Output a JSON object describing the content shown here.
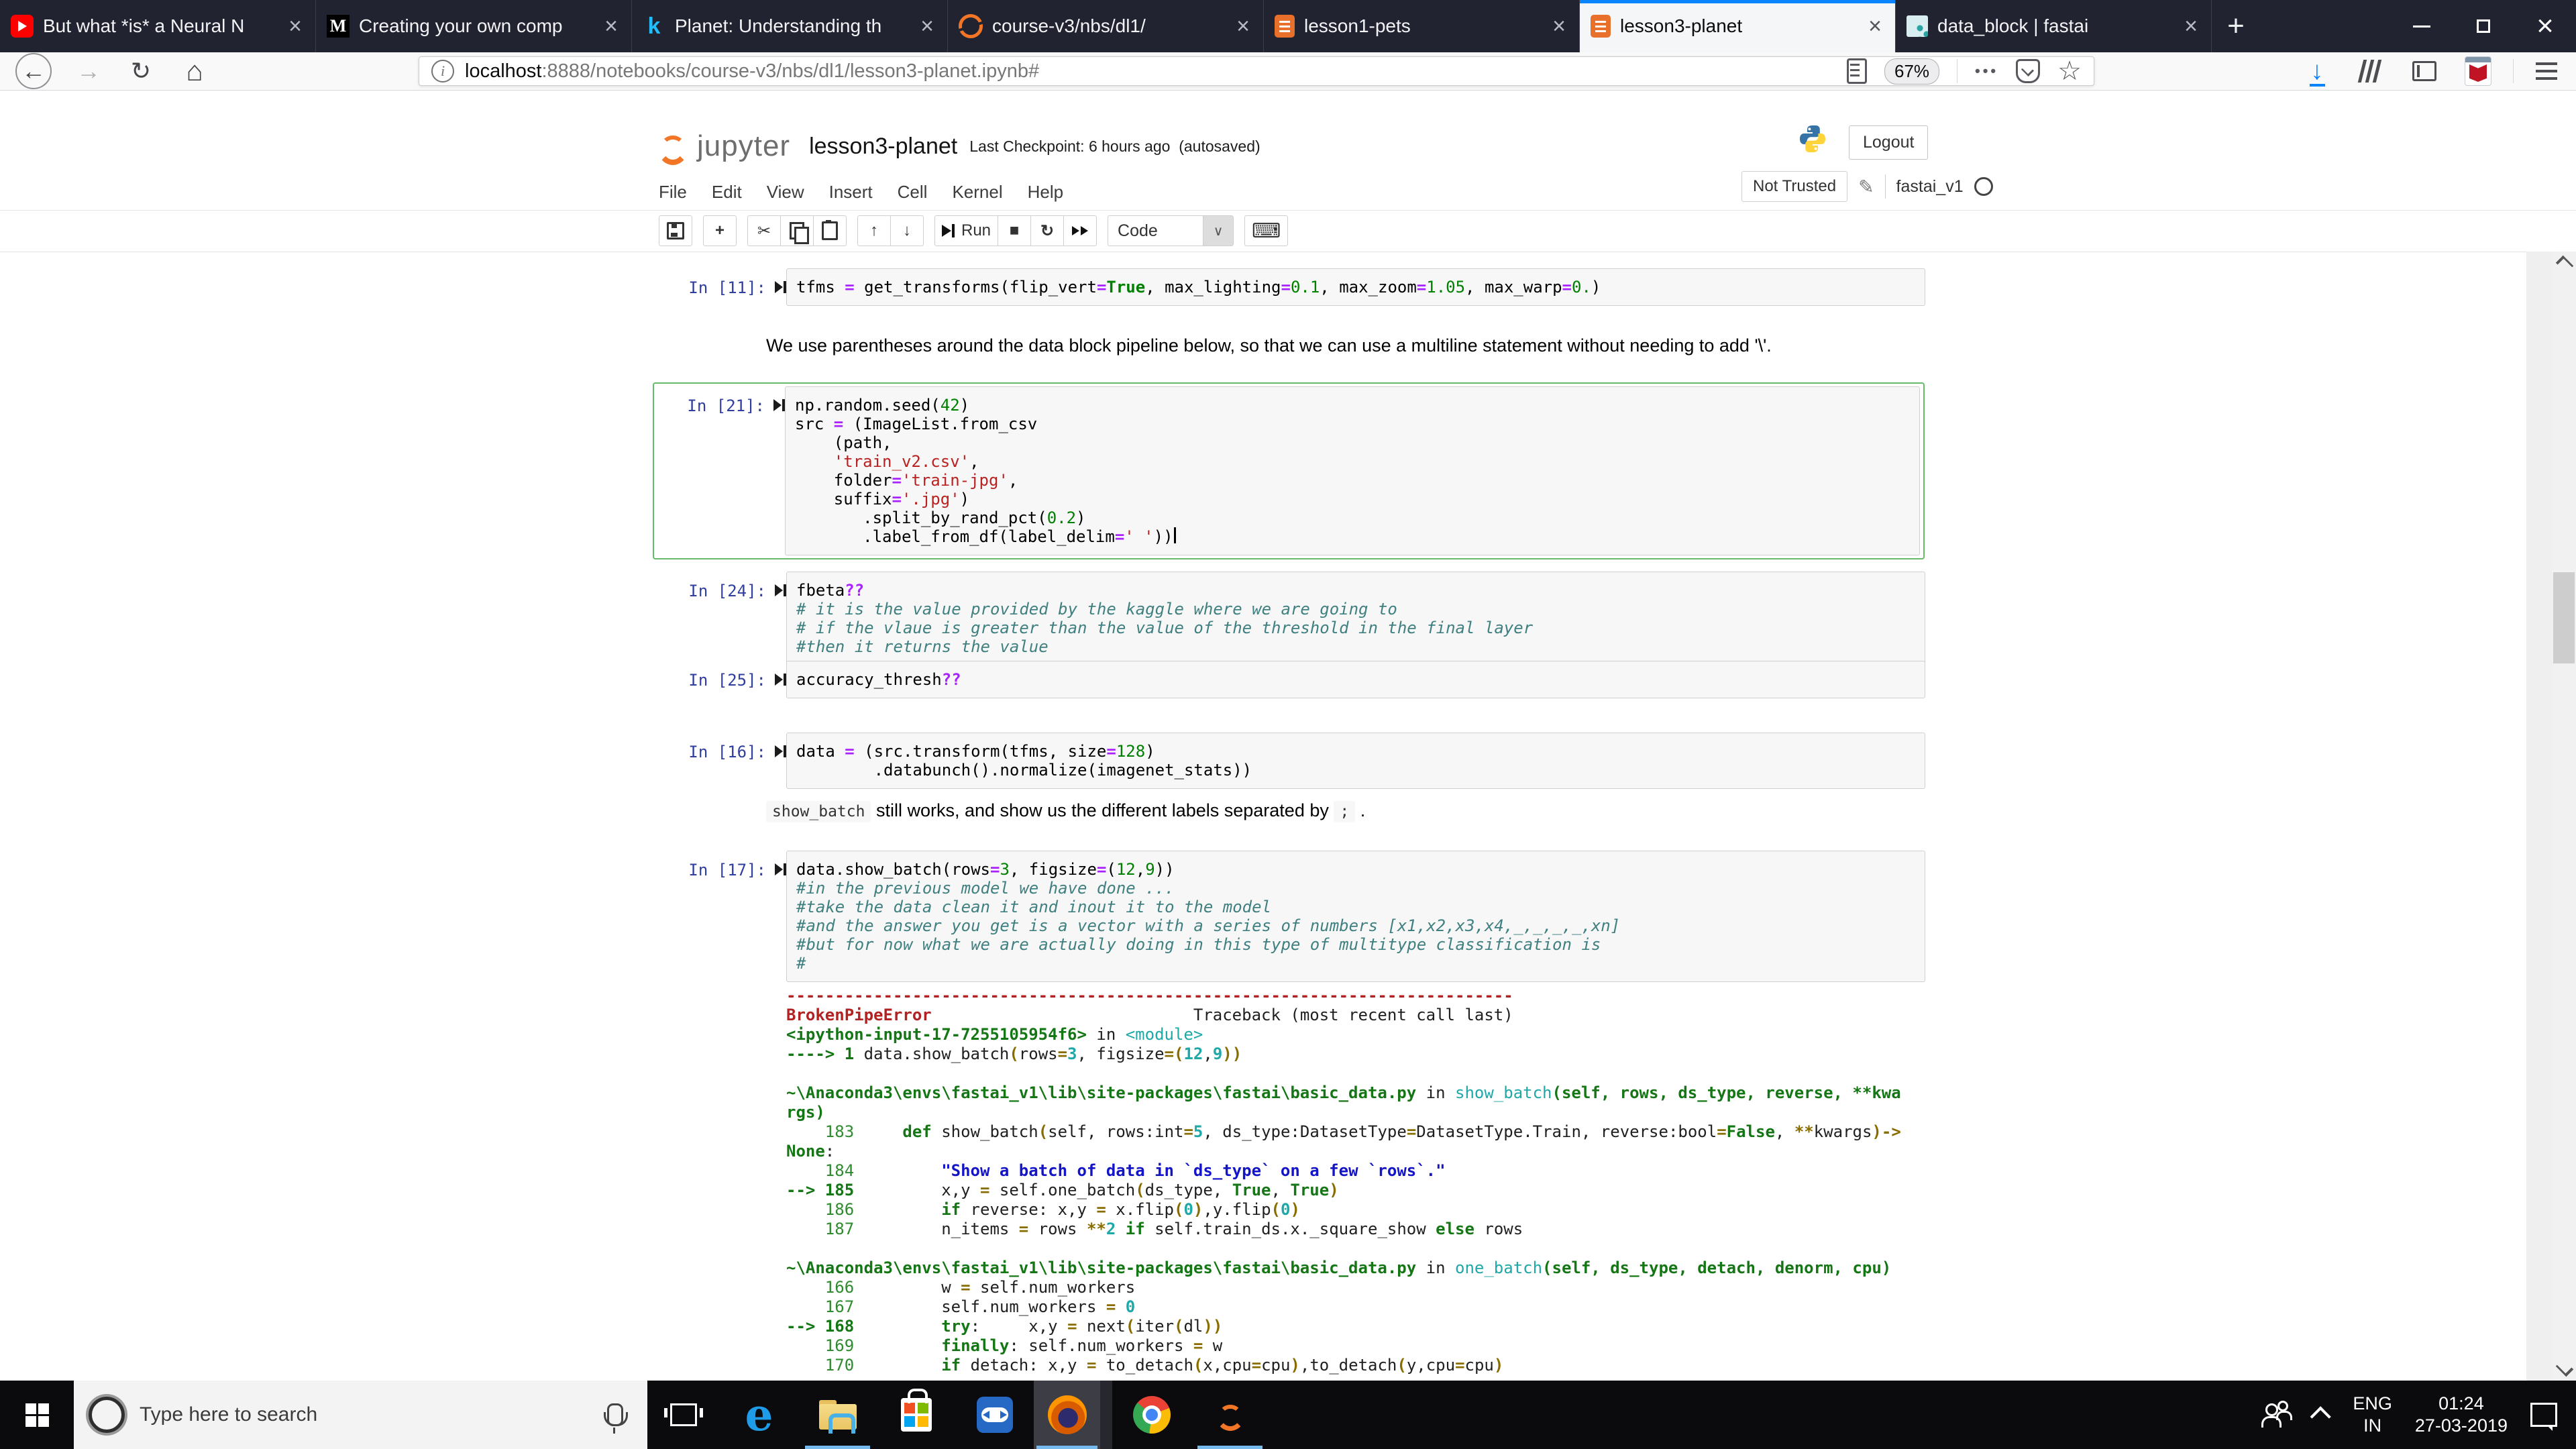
{
  "browser": {
    "tabs": [
      {
        "title": "But what *is* a Neural N",
        "icon": "youtube",
        "active": false
      },
      {
        "title": "Creating your own comp",
        "icon": "medium",
        "active": false
      },
      {
        "title": "Planet: Understanding th",
        "icon": "kaggle",
        "active": false
      },
      {
        "title": "course-v3/nbs/dl1/",
        "icon": "jupyter",
        "active": false
      },
      {
        "title": "lesson1-pets",
        "icon": "notebook",
        "active": false
      },
      {
        "title": "lesson3-planet",
        "icon": "notebook",
        "active": true
      },
      {
        "title": "data_block | fastai",
        "icon": "fastai",
        "active": false
      }
    ],
    "url": {
      "host": "localhost",
      "rest": ":8888/notebooks/course-v3/nbs/dl1/lesson3-planet.ipynb#"
    },
    "zoom_badge": "67%"
  },
  "jupyter": {
    "logo_text": "jupyter",
    "notebook_title": "lesson3-planet",
    "checkpoint": "Last Checkpoint: 6 hours ago",
    "autosave": "(autosaved)",
    "logout_label": "Logout",
    "menu": [
      "File",
      "Edit",
      "View",
      "Insert",
      "Cell",
      "Kernel",
      "Help"
    ],
    "trust_label": "Not Trusted",
    "kernel_name": "fastai_v1",
    "toolbar": {
      "run_label": "Run",
      "cell_type": "Code"
    }
  },
  "colors": {
    "accent_blue": "#0a84ff",
    "selected_cell_green": "#66bb6a",
    "jupyter_orange": "#f37626",
    "prompt_blue": "#303f9f",
    "error_red": "#b22222"
  },
  "notebook": {
    "cells": [
      {
        "type": "code",
        "prompt": "In [11]:",
        "lines": [
          [
            [
              "d",
              "tfms "
            ],
            [
              "op",
              "="
            ],
            [
              "d",
              " get_transforms(flip_vert"
            ],
            [
              "op",
              "="
            ],
            [
              "kw",
              "True"
            ],
            [
              "d",
              ", max_lighting"
            ],
            [
              "op",
              "="
            ],
            [
              "num",
              "0.1"
            ],
            [
              "d",
              ", max_zoom"
            ],
            [
              "op",
              "="
            ],
            [
              "num",
              "1.05"
            ],
            [
              "d",
              ", max_warp"
            ],
            [
              "op",
              "="
            ],
            [
              "num",
              "0."
            ],
            [
              "d",
              ")"
            ]
          ]
        ]
      },
      {
        "type": "markdown",
        "runs": [
          {
            "t": "We use parentheses around the data block pipeline below, so that we can use a multiline statement without needing to add '\\'."
          }
        ]
      },
      {
        "type": "code",
        "prompt": "In [21]:",
        "selected": true,
        "lines": [
          [
            [
              "d",
              "np.random.seed("
            ],
            [
              "num",
              "42"
            ],
            [
              "d",
              ")"
            ]
          ],
          [
            [
              "d",
              "src "
            ],
            [
              "op",
              "="
            ],
            [
              "d",
              " (ImageList.from_csv"
            ]
          ],
          [
            [
              "d",
              "    (path,"
            ]
          ],
          [
            [
              "d",
              "    "
            ],
            [
              "str",
              "'train_v2.csv'"
            ],
            [
              "d",
              ","
            ]
          ],
          [
            [
              "d",
              "    folder"
            ],
            [
              "op",
              "="
            ],
            [
              "str",
              "'train-jpg'"
            ],
            [
              "d",
              ","
            ]
          ],
          [
            [
              "d",
              "    suffix"
            ],
            [
              "op",
              "="
            ],
            [
              "str",
              "'.jpg'"
            ],
            [
              "d",
              ")"
            ]
          ],
          [
            [
              "d",
              "       .split_by_rand_pct("
            ],
            [
              "num",
              "0.2"
            ],
            [
              "d",
              ")"
            ]
          ],
          [
            [
              "d",
              "       .label_from_df(label_delim"
            ],
            [
              "op",
              "="
            ],
            [
              "str",
              "' '"
            ],
            [
              "d",
              "))"
            ],
            [
              "cur",
              ""
            ]
          ]
        ]
      },
      {
        "type": "code",
        "prompt": "In [24]:",
        "lines": [
          [
            [
              "d",
              "fbeta"
            ],
            [
              "op",
              "??"
            ]
          ],
          [
            [
              "com",
              "# it is the value provided by the kaggle where we are going to"
            ]
          ],
          [
            [
              "com",
              "# if the vlaue is greater than the value of the threshold in the final layer"
            ]
          ],
          [
            [
              "com",
              "#then it returns the value"
            ]
          ]
        ]
      },
      {
        "type": "code",
        "prompt": "In [25]:",
        "lines": [
          [
            [
              "d",
              "accuracy_thresh"
            ],
            [
              "op",
              "??"
            ]
          ]
        ]
      },
      {
        "type": "code",
        "prompt": "In [16]:",
        "lines": [
          [
            [
              "d",
              "data "
            ],
            [
              "op",
              "="
            ],
            [
              "d",
              " (src.transform(tfms, size"
            ],
            [
              "op",
              "="
            ],
            [
              "num",
              "128"
            ],
            [
              "d",
              ")"
            ]
          ],
          [
            [
              "d",
              "        .databunch().normalize(imagenet_stats))"
            ]
          ]
        ]
      },
      {
        "type": "markdown",
        "runs": [
          {
            "c": "show_batch"
          },
          {
            "t": " still works, and show us the different labels separated by "
          },
          {
            "c": ";"
          },
          {
            "t": " ."
          }
        ]
      },
      {
        "type": "code",
        "prompt": "In [17]:",
        "lines": [
          [
            [
              "d",
              "data.show_batch(rows"
            ],
            [
              "op",
              "="
            ],
            [
              "num",
              "3"
            ],
            [
              "d",
              ", figsize"
            ],
            [
              "op",
              "="
            ],
            [
              "d",
              "("
            ],
            [
              "num",
              "12"
            ],
            [
              "d",
              ","
            ],
            [
              "num",
              "9"
            ],
            [
              "d",
              "))"
            ]
          ],
          [
            [
              "com",
              "#in the previous model we have done ..."
            ]
          ],
          [
            [
              "com",
              "#take the data clean it and inout it to the model"
            ]
          ],
          [
            [
              "com",
              "#and the answer you get is a vector with a series of numbers [x1,x2,x3,x4,_,_,_,_,xn]"
            ]
          ],
          [
            [
              "com",
              "#but for now what we are actually doing in this type of multitype classification is"
            ]
          ],
          [
            [
              "com",
              "#"
            ]
          ]
        ]
      }
    ],
    "traceback": [
      [
        [
          "hr",
          "---------------------------------------------------------------------------"
        ]
      ],
      [
        [
          "red",
          "BrokenPipeError"
        ],
        [
          "d",
          "                           Traceback (most recent call last)"
        ]
      ],
      [
        [
          "grn",
          "<ipython-input-17-7255105954f6>"
        ],
        [
          "d",
          " in "
        ],
        [
          "teal",
          "<module>"
        ]
      ],
      [
        [
          "grn",
          "----> 1"
        ],
        [
          "d",
          " data.show_batch"
        ],
        [
          "oli",
          "("
        ],
        [
          "d",
          "rows"
        ],
        [
          "oli",
          "="
        ],
        [
          "tln",
          "3"
        ],
        [
          "d",
          ", figsize"
        ],
        [
          "oli",
          "="
        ],
        [
          "oli",
          "("
        ],
        [
          "tln",
          "12"
        ],
        [
          "d",
          ","
        ],
        [
          "tln",
          "9"
        ],
        [
          "oli",
          "))"
        ]
      ],
      [],
      [
        [
          "grn",
          "~\\Anaconda3\\envs\\fastai_v1\\lib\\site-packages\\fastai\\basic_data.py"
        ],
        [
          "d",
          " in "
        ],
        [
          "teal",
          "show_batch"
        ],
        [
          "grn",
          "(self, rows, ds_type, reverse, **kwa"
        ]
      ],
      [
        [
          "grn",
          "rgs)"
        ]
      ],
      [
        [
          "lno",
          "    183"
        ],
        [
          "d",
          "     "
        ],
        [
          "kw",
          "def"
        ],
        [
          "d",
          " show_batch"
        ],
        [
          "oli",
          "("
        ],
        [
          "d",
          "self, rows:int"
        ],
        [
          "oli",
          "="
        ],
        [
          "tln",
          "5"
        ],
        [
          "d",
          ", ds_type:DatasetType"
        ],
        [
          "oli",
          "="
        ],
        [
          "d",
          "DatasetType.Train, reverse:bool"
        ],
        [
          "oli",
          "="
        ],
        [
          "kw",
          "False"
        ],
        [
          "d",
          ", "
        ],
        [
          "oli",
          "**"
        ],
        [
          "d",
          "kwargs"
        ],
        [
          "oli",
          ")->"
        ]
      ],
      [
        [
          "kw",
          "None"
        ],
        [
          "d",
          ":"
        ]
      ],
      [
        [
          "lno",
          "    184"
        ],
        [
          "d",
          "         "
        ],
        [
          "blu",
          "\"Show a batch of data in `ds_type` on a few `rows`.\""
        ]
      ],
      [
        [
          "grn",
          "--> 185"
        ],
        [
          "d",
          "         x,y "
        ],
        [
          "oli",
          "="
        ],
        [
          "d",
          " self.one_batch"
        ],
        [
          "oli",
          "("
        ],
        [
          "d",
          "ds_type, "
        ],
        [
          "kw",
          "True"
        ],
        [
          "d",
          ", "
        ],
        [
          "kw",
          "True"
        ],
        [
          "oli",
          ")"
        ]
      ],
      [
        [
          "lno",
          "    186"
        ],
        [
          "d",
          "         "
        ],
        [
          "kw",
          "if"
        ],
        [
          "d",
          " reverse: x,y "
        ],
        [
          "oli",
          "="
        ],
        [
          "d",
          " x.flip"
        ],
        [
          "oli",
          "("
        ],
        [
          "tln",
          "0"
        ],
        [
          "oli",
          ")"
        ],
        [
          "d",
          ",y.flip"
        ],
        [
          "oli",
          "("
        ],
        [
          "tln",
          "0"
        ],
        [
          "oli",
          ")"
        ]
      ],
      [
        [
          "lno",
          "    187"
        ],
        [
          "d",
          "         n_items "
        ],
        [
          "oli",
          "="
        ],
        [
          "d",
          " rows "
        ],
        [
          "oli",
          "**"
        ],
        [
          "tln",
          "2"
        ],
        [
          "d",
          " "
        ],
        [
          "kw",
          "if"
        ],
        [
          "d",
          " self.train_ds.x._square_show "
        ],
        [
          "kw",
          "else"
        ],
        [
          "d",
          " rows"
        ]
      ],
      [],
      [
        [
          "grn",
          "~\\Anaconda3\\envs\\fastai_v1\\lib\\site-packages\\fastai\\basic_data.py"
        ],
        [
          "d",
          " in "
        ],
        [
          "teal",
          "one_batch"
        ],
        [
          "grn",
          "(self, ds_type, detach, denorm, cpu)"
        ]
      ],
      [
        [
          "lno",
          "    166"
        ],
        [
          "d",
          "         w "
        ],
        [
          "oli",
          "="
        ],
        [
          "d",
          " self.num_workers"
        ]
      ],
      [
        [
          "lno",
          "    167"
        ],
        [
          "d",
          "         self.num_workers "
        ],
        [
          "oli",
          "="
        ],
        [
          "d",
          " "
        ],
        [
          "tln",
          "0"
        ]
      ],
      [
        [
          "grn",
          "--> 168"
        ],
        [
          "d",
          "         "
        ],
        [
          "kw",
          "try"
        ],
        [
          "d",
          ":     x,y "
        ],
        [
          "oli",
          "="
        ],
        [
          "d",
          " next"
        ],
        [
          "oli",
          "("
        ],
        [
          "d",
          "iter"
        ],
        [
          "oli",
          "("
        ],
        [
          "d",
          "dl"
        ],
        [
          "oli",
          "))"
        ]
      ],
      [
        [
          "lno",
          "    169"
        ],
        [
          "d",
          "         "
        ],
        [
          "kw",
          "finally"
        ],
        [
          "d",
          ": self.num_workers "
        ],
        [
          "oli",
          "="
        ],
        [
          "d",
          " w"
        ]
      ],
      [
        [
          "lno",
          "    170"
        ],
        [
          "d",
          "         "
        ],
        [
          "kw",
          "if"
        ],
        [
          "d",
          " detach: x,y "
        ],
        [
          "oli",
          "="
        ],
        [
          "d",
          " to_detach"
        ],
        [
          "oli",
          "("
        ],
        [
          "d",
          "x,cpu"
        ],
        [
          "oli",
          "="
        ],
        [
          "d",
          "cpu"
        ],
        [
          "oli",
          ")"
        ],
        [
          "d",
          ",to_detach"
        ],
        [
          "oli",
          "("
        ],
        [
          "d",
          "y,cpu"
        ],
        [
          "oli",
          "="
        ],
        [
          "d",
          "cpu"
        ],
        [
          "oli",
          ")"
        ]
      ]
    ]
  },
  "taskbar": {
    "search_placeholder": "Type here to search",
    "language": "ENG",
    "region": "IN",
    "time": "01:24",
    "date": "27-03-2019"
  }
}
